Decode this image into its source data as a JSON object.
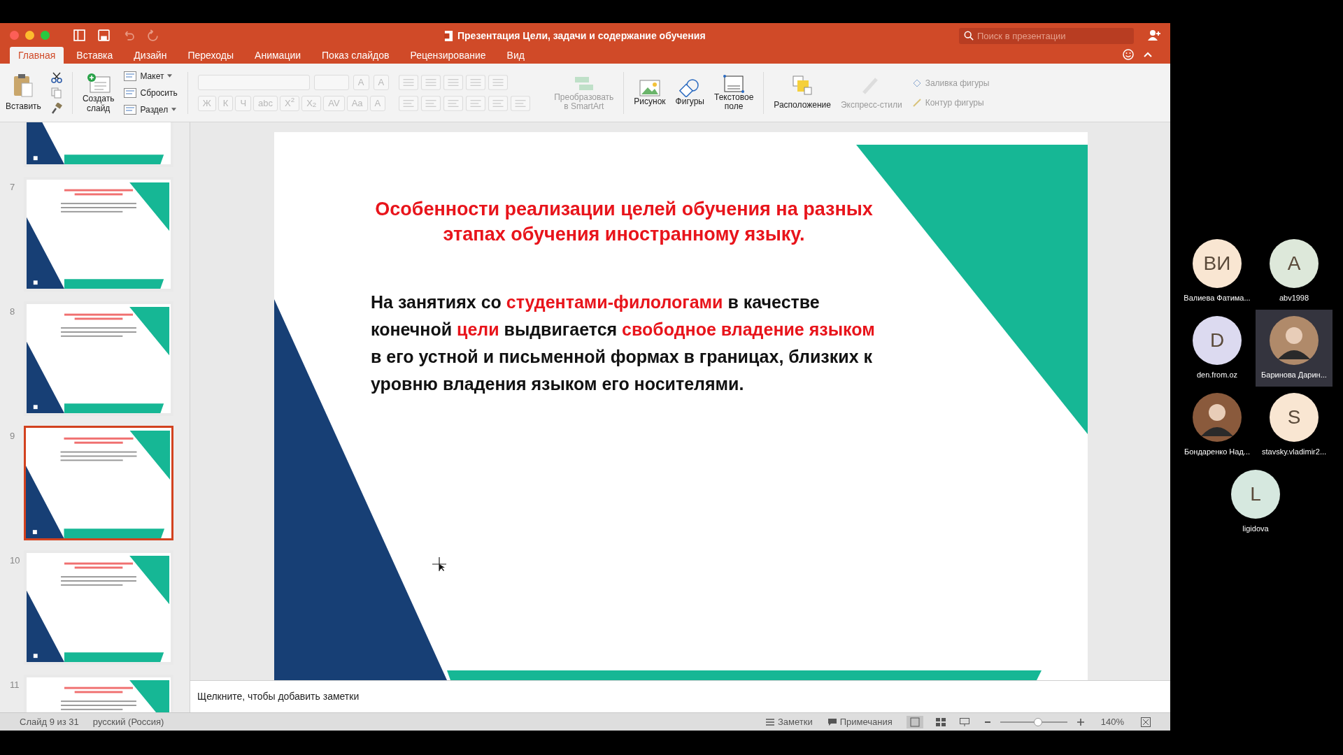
{
  "window": {
    "title": "Презентация Цели, задачи и содержание обучения",
    "search": {
      "placeholder": "Поиск в презентации"
    }
  },
  "tabs": [
    {
      "label": "Главная",
      "selected": true
    },
    {
      "label": "Вставка",
      "selected": false
    },
    {
      "label": "Дизайн",
      "selected": false
    },
    {
      "label": "Переходы",
      "selected": false
    },
    {
      "label": "Анимации",
      "selected": false
    },
    {
      "label": "Показ слайдов",
      "selected": false
    },
    {
      "label": "Рецензирование",
      "selected": false
    },
    {
      "label": "Вид",
      "selected": false
    }
  ],
  "ribbon": {
    "paste": "Вставить",
    "new_slide": [
      "Создать",
      "слайд"
    ],
    "slide_commands": [
      {
        "label": "Макет",
        "dropdown": true
      },
      {
        "label": "Сбросить",
        "dropdown": false
      },
      {
        "label": "Раздел",
        "dropdown": true
      }
    ],
    "font_size_buttons": [
      "A",
      "A"
    ],
    "format_buttons": [
      "Ж",
      "К",
      "Ч",
      "abc",
      "X$^{2}$",
      "X$_{2}$",
      "AV",
      "Aa",
      "A"
    ],
    "smartart": {
      "label": [
        "Преобразовать",
        "в SmartArt"
      ],
      "disabled": true
    },
    "insert": [
      {
        "kind": "picture",
        "label": [
          "Рисунок"
        ]
      },
      {
        "kind": "shapes",
        "label": [
          "Фигуры"
        ]
      },
      {
        "kind": "textbox",
        "label": [
          "Текстовое",
          "поле"
        ]
      }
    ],
    "arrange": [
      {
        "kind": "arrange",
        "label": "Расположение",
        "disabled": false
      },
      {
        "kind": "styles",
        "label": "Экспресс-стили",
        "disabled": true
      }
    ],
    "shape_format": [
      {
        "kind": "fill",
        "label": "Заливка фигуры",
        "disabled": true
      },
      {
        "kind": "outline",
        "label": "Контур фигуры",
        "disabled": true
      }
    ]
  },
  "slides": [
    {
      "selected": false
    },
    {
      "number": "7",
      "selected": false
    },
    {
      "number": "8",
      "selected": false
    },
    {
      "number": "9",
      "selected": true
    },
    {
      "number": "10",
      "selected": false
    },
    {
      "number": "11",
      "selected": false
    }
  ],
  "slide": {
    "title": [
      "Особенности реализации целей обучения на разных",
      "этапах обучения иностранному языку."
    ],
    "body": [
      [
        {
          "text": "На занятиях со ",
          "highlight": false
        },
        {
          "text": "студентами-филологами",
          "highlight": true
        },
        {
          "text": " в качестве",
          "highlight": false
        }
      ],
      [
        {
          "text": "конечной ",
          "highlight": false
        },
        {
          "text": "цели",
          "highlight": true
        },
        {
          "text": " выдвигается ",
          "highlight": false
        },
        {
          "text": "свободное владение языком",
          "highlight": true
        }
      ],
      [
        {
          "text": "в его устной и письменной формах в границах, близких к",
          "highlight": false
        }
      ],
      [
        {
          "text": "уровню владения языком его носителями.",
          "highlight": false
        }
      ]
    ]
  },
  "notes": {
    "placeholder": "Щелкните, чтобы добавить заметки"
  },
  "status_bar": {
    "slide": "Слайд 9 из 31",
    "language": "русский (Россия)",
    "notes": "Заметки",
    "comments": "Примечания",
    "zoom": {
      "level": 0.56,
      "reading": "140%"
    }
  },
  "participants": [
    {
      "kind": "initials",
      "initials": "ВИ",
      "name": "Валиева Фатима...",
      "color": "#f9e6d2",
      "selected": false
    },
    {
      "kind": "initials",
      "initials": "A",
      "name": "abv1998",
      "color": "#dde8da",
      "selected": false
    },
    {
      "kind": "initials",
      "initials": "D",
      "name": "den.from.oz",
      "color": "#dcdaf0",
      "selected": false
    },
    {
      "kind": "photo",
      "name": "Баринова Дарин...",
      "color": "#b08a6a",
      "selected": true
    },
    {
      "kind": "photo",
      "name": "Бондаренко Над...",
      "color": "#8a5a3c",
      "selected": false
    },
    {
      "kind": "initials",
      "initials": "S",
      "name": "stavsky.vladimir2...",
      "color": "#f9e6d2",
      "selected": false
    },
    {
      "kind": "initials",
      "initials": "L",
      "name": "ligidova",
      "color": "#d6e8df",
      "selected": false
    }
  ]
}
